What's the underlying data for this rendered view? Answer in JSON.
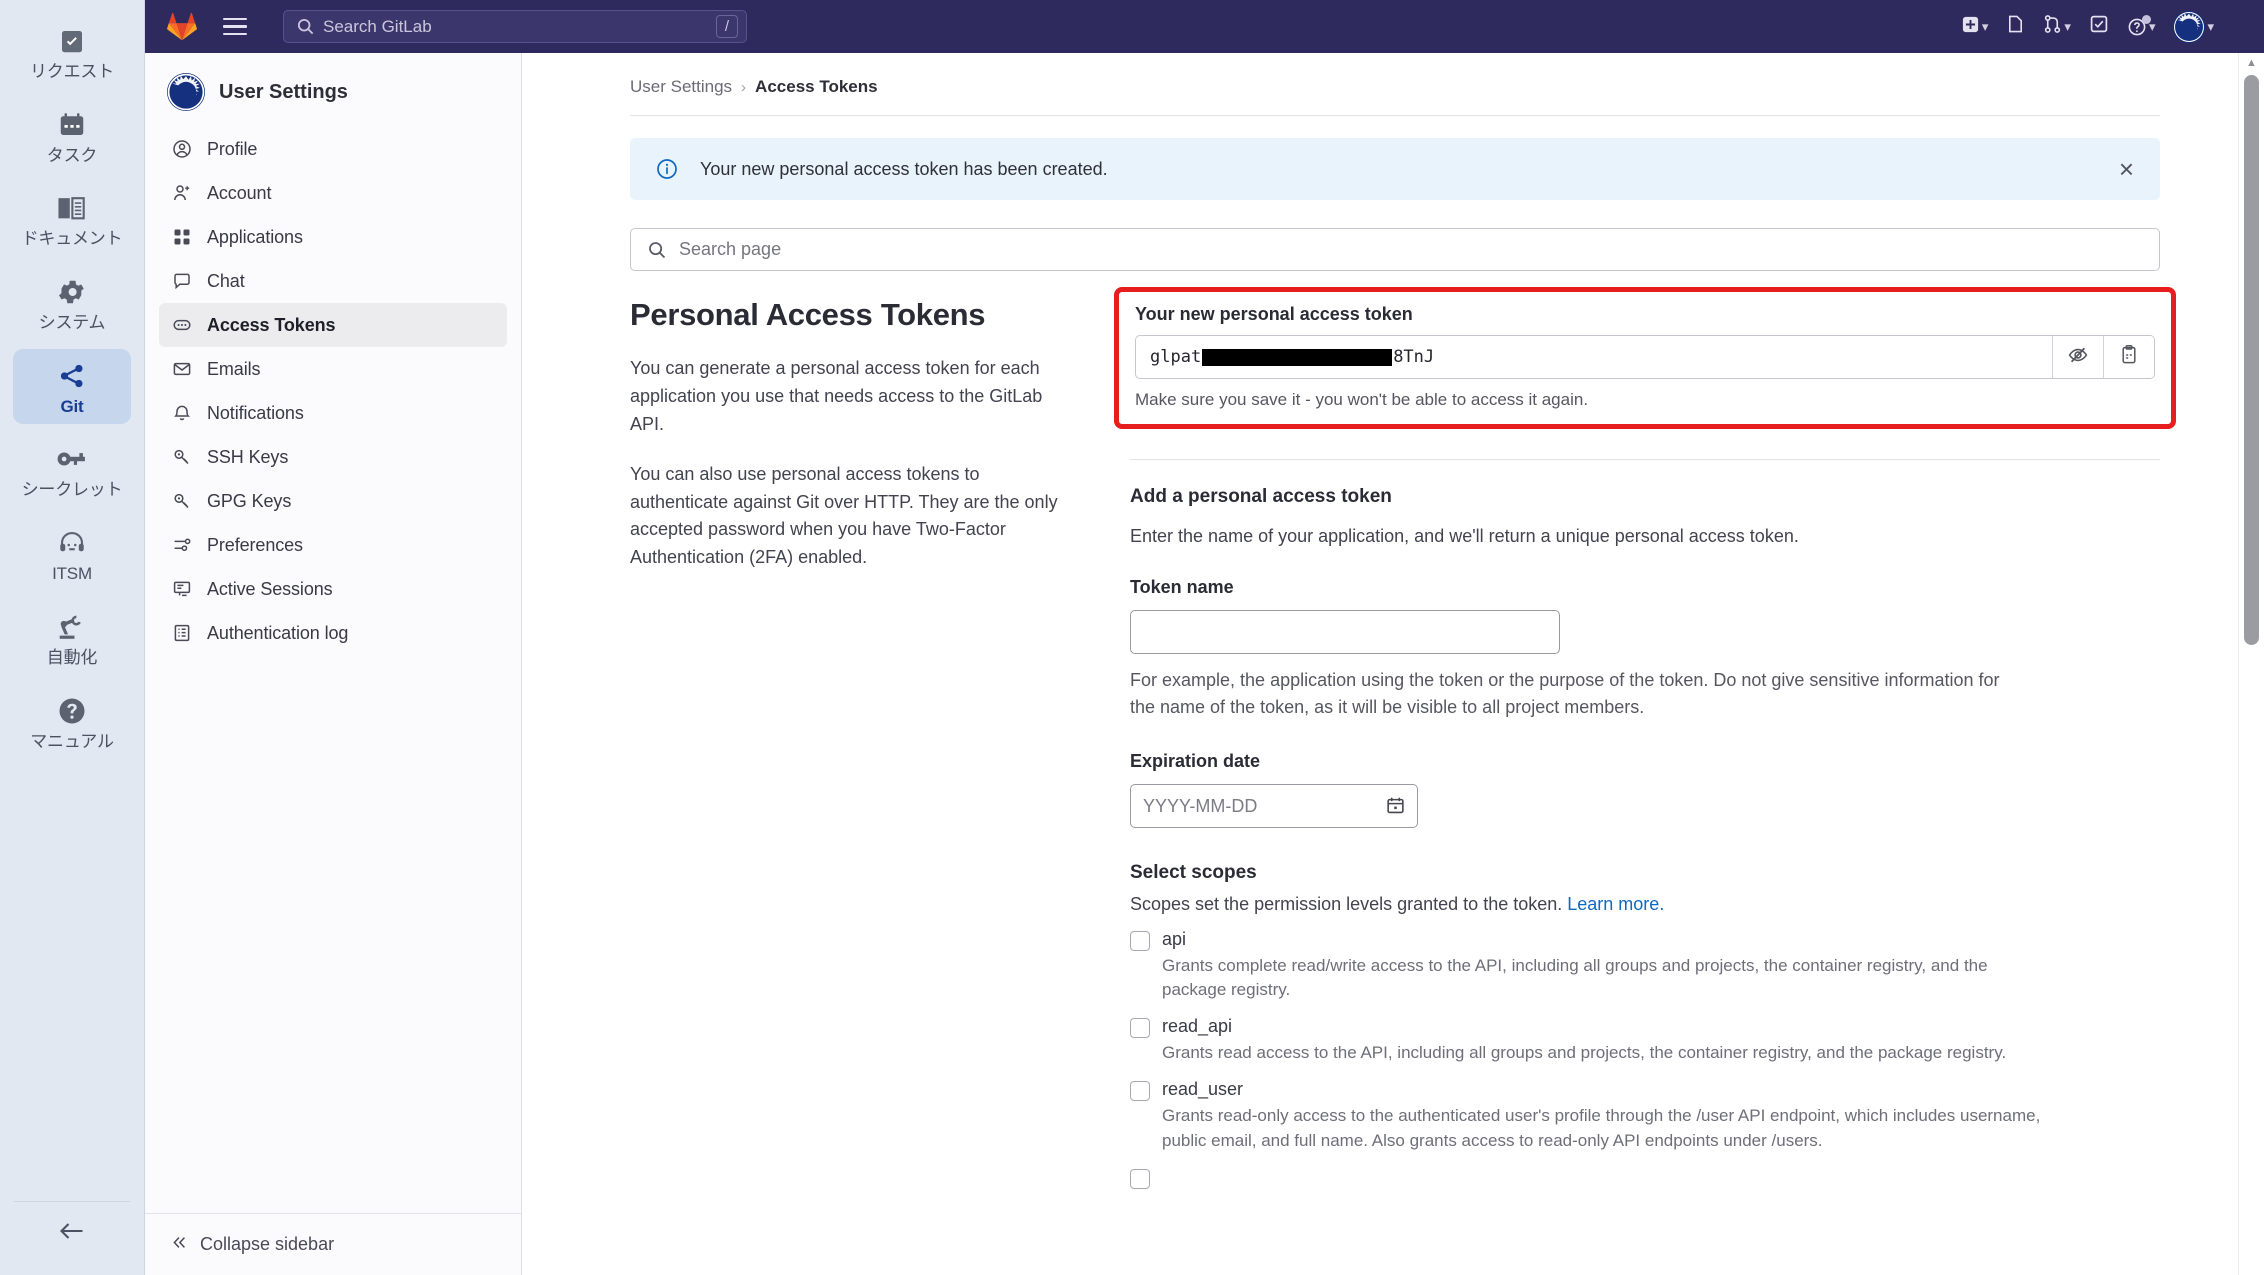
{
  "app_rail": {
    "items": [
      {
        "label": "リクエスト",
        "icon": "clipboard-check-icon",
        "active": false
      },
      {
        "label": "タスク",
        "icon": "calendar-icon",
        "active": false
      },
      {
        "label": "ドキュメント",
        "icon": "book-icon",
        "active": false
      },
      {
        "label": "システム",
        "icon": "gear-icon",
        "active": false
      },
      {
        "label": "Git",
        "icon": "share-nodes-icon",
        "active": true
      },
      {
        "label": "シークレット",
        "icon": "key-icon",
        "active": false
      },
      {
        "label": "ITSM",
        "icon": "headset-icon",
        "active": false
      },
      {
        "label": "自動化",
        "icon": "robot-arm-icon",
        "active": false
      },
      {
        "label": "マニュアル",
        "icon": "question-circle-icon",
        "active": false
      }
    ],
    "back_icon": "arrow-left-icon"
  },
  "topbar": {
    "logo": "gitlab-logo",
    "menu_icon": "hamburger-icon",
    "search_placeholder": "Search GitLab",
    "search_icon": "search-icon",
    "shortcut_key": "/",
    "actions": [
      {
        "name": "create-new-menu",
        "icon": "plus-square-icon",
        "has_caret": true
      },
      {
        "name": "issues-button",
        "icon": "issue-icon",
        "has_caret": false
      },
      {
        "name": "merge-requests-menu",
        "icon": "merge-request-icon",
        "has_caret": true
      },
      {
        "name": "todos-button",
        "icon": "todo-check-icon",
        "has_caret": false
      },
      {
        "name": "help-menu",
        "icon": "question-circle-icon",
        "has_caret": true
      },
      {
        "name": "user-menu",
        "icon": "user-avatar",
        "has_caret": true
      }
    ],
    "background": "#2e2a5e"
  },
  "sidebar": {
    "title": "User Settings",
    "avatar_icon": "user-avatar",
    "items": [
      {
        "label": "Profile",
        "icon": "user-circle-icon",
        "active": false
      },
      {
        "label": "Account",
        "icon": "account-icon",
        "active": false
      },
      {
        "label": "Applications",
        "icon": "grid-apps-icon",
        "active": false
      },
      {
        "label": "Chat",
        "icon": "comment-icon",
        "active": false
      },
      {
        "label": "Access Tokens",
        "icon": "token-icon",
        "active": true
      },
      {
        "label": "Emails",
        "icon": "envelope-icon",
        "active": false
      },
      {
        "label": "Notifications",
        "icon": "bell-icon",
        "active": false
      },
      {
        "label": "SSH Keys",
        "icon": "key-icon",
        "active": false
      },
      {
        "label": "GPG Keys",
        "icon": "key-icon",
        "active": false
      },
      {
        "label": "Preferences",
        "icon": "sliders-icon",
        "active": false
      },
      {
        "label": "Active Sessions",
        "icon": "monitor-icon",
        "active": false
      },
      {
        "label": "Authentication log",
        "icon": "list-log-icon",
        "active": false
      }
    ],
    "collapse_label": "Collapse sidebar",
    "collapse_icon": "chevron-double-left-icon"
  },
  "breadcrumb": {
    "parent": "User Settings",
    "separator": "›",
    "current": "Access Tokens"
  },
  "alert": {
    "icon": "info-circle-icon",
    "message": "Your new personal access token has been created.",
    "close_icon": "close-icon",
    "background": "#e9f3fc",
    "accent": "#1068bf"
  },
  "page_search": {
    "icon": "search-icon",
    "placeholder": "Search page"
  },
  "intro": {
    "title": "Personal Access Tokens",
    "paragraph1": "You can generate a personal access token for each application you use that needs access to the GitLab API.",
    "paragraph2": "You can also use personal access tokens to authenticate against Git over HTTP. They are the only accepted password when you have Two-Factor Authentication (2FA) enabled."
  },
  "new_token": {
    "label": "Your new personal access token",
    "value_prefix": "glpat",
    "value_redacted": true,
    "value_suffix": "8TnJ",
    "reveal_icon": "eye-slash-icon",
    "copy_icon": "clipboard-copy-icon",
    "hint": "Make sure you save it - you won't be able to access it again.",
    "highlight_color": "#e61e1e"
  },
  "add_token": {
    "section_title": "Add a personal access token",
    "section_desc": "Enter the name of your application, and we'll return a unique personal access token.",
    "token_name_label": "Token name",
    "token_name_value": "",
    "token_name_placeholder": "",
    "token_name_help": "For example, the application using the token or the purpose of the token. Do not give sensitive information for the name of the token, as it will be visible to all project members.",
    "expiration_label": "Expiration date",
    "expiration_value": "",
    "expiration_placeholder": "YYYY-MM-DD",
    "calendar_icon": "calendar-icon"
  },
  "scopes": {
    "title": "Select scopes",
    "desc_prefix": "Scopes set the permission levels granted to the token.",
    "learn_more": "Learn more.",
    "items": [
      {
        "name": "api",
        "checked": false,
        "description": "Grants complete read/write access to the API, including all groups and projects, the container registry, and the package registry."
      },
      {
        "name": "read_api",
        "checked": false,
        "description": "Grants read access to the API, including all groups and projects, the container registry, and the package registry."
      },
      {
        "name": "read_user",
        "checked": false,
        "description": "Grants read-only access to the authenticated user's profile through the /user API endpoint, which includes username, public email, and full name. Also grants access to read-only API endpoints under /users."
      }
    ]
  },
  "scrollbar": {
    "up_arrow_icon": "triangle-up-icon",
    "thumb": "scroll-thumb"
  }
}
